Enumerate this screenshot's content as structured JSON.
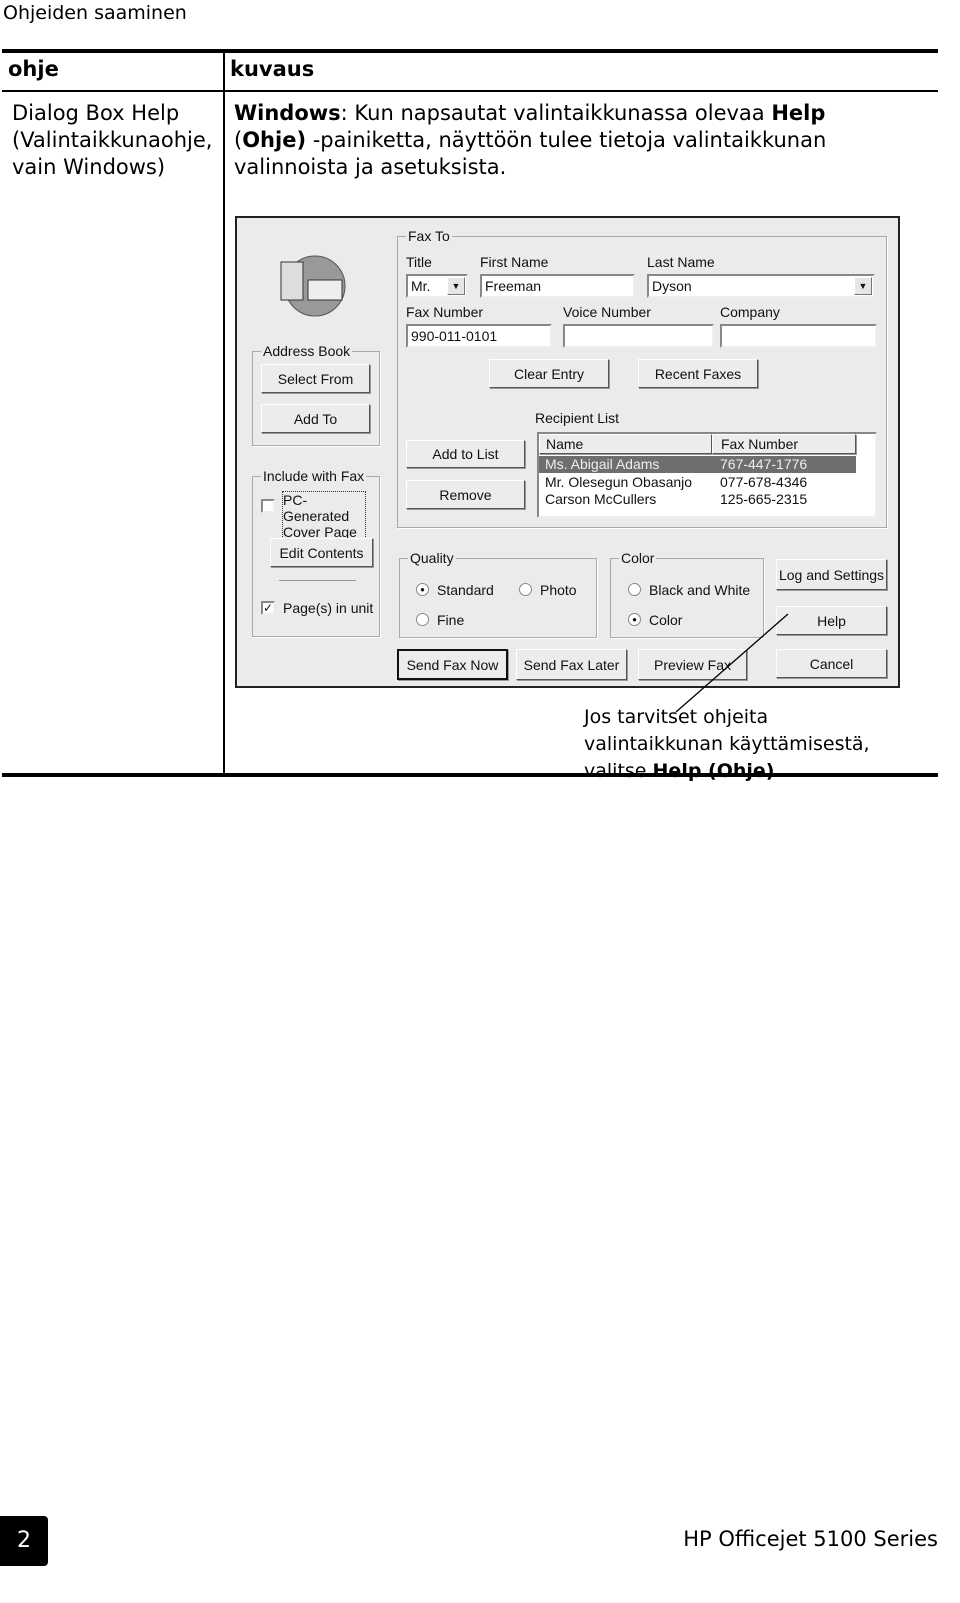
{
  "page_header": "Ohjeiden saaminen",
  "table": {
    "headers": [
      "ohje",
      "kuvaus"
    ],
    "row": {
      "topic": "Dialog Box Help (Valintaikkunaohje, vain Windows)",
      "desc_bold1": "Windows",
      "desc_t1": ": Kun napsautat valintaikkunassa olevaa ",
      "desc_bold2": "Help",
      "desc_t2": " (",
      "desc_bold3": "Ohje)",
      "desc_t3": " -painiketta, näyttöön tulee tietoja valintaikkunan valinnoista ja asetuksista."
    }
  },
  "dialog": {
    "fax_to": {
      "legend": "Fax To",
      "title_label": "Title",
      "title_value": "Mr.",
      "first_label": "First Name",
      "first_value": "Freeman",
      "last_label": "Last Name",
      "last_value": "Dyson",
      "fax_label": "Fax Number",
      "fax_value": "990-011-0101",
      "voice_label": "Voice Number",
      "voice_value": "",
      "company_label": "Company",
      "company_value": "",
      "clear": "Clear Entry",
      "recent": "Recent Faxes",
      "recipient_label": "Recipient List",
      "add_to_list": "Add to List",
      "remove": "Remove",
      "list": {
        "headers": [
          "Name",
          "Fax Number"
        ],
        "rows": [
          {
            "name": "Ms. Abigail Adams",
            "fax": "767-447-1776",
            "selected": true
          },
          {
            "name": "Mr. Olesegun Obasanjo",
            "fax": "077-678-4346"
          },
          {
            "name": "Carson McCullers",
            "fax": "125-665-2315"
          }
        ]
      }
    },
    "address_book": {
      "legend": "Address Book",
      "select_from": "Select From",
      "add_to": "Add To"
    },
    "include": {
      "legend": "Include with Fax",
      "cover_page": "PC-Generated Cover Page",
      "cover_checked": false,
      "edit_contents": "Edit Contents",
      "pages_in_unit": "Page(s) in unit",
      "pages_checked": true
    },
    "quality": {
      "legend": "Quality",
      "standard": "Standard",
      "photo": "Photo",
      "fine": "Fine",
      "selected": "Standard"
    },
    "color": {
      "legend": "Color",
      "bw": "Black and White",
      "color": "Color",
      "selected": "Color"
    },
    "log_settings": "Log and Settings",
    "help": "Help",
    "send_now": "Send Fax Now",
    "send_later": "Send Fax Later",
    "preview": "Preview Fax",
    "cancel": "Cancel"
  },
  "callout": {
    "text": "Jos tarvitset ohjeita valintaikkunan käyttämisestä, valitse ",
    "bold": "Help (Ohje)",
    "end": "."
  },
  "footer": {
    "page_number": "2",
    "product": "HP Officejet 5100 Series"
  }
}
